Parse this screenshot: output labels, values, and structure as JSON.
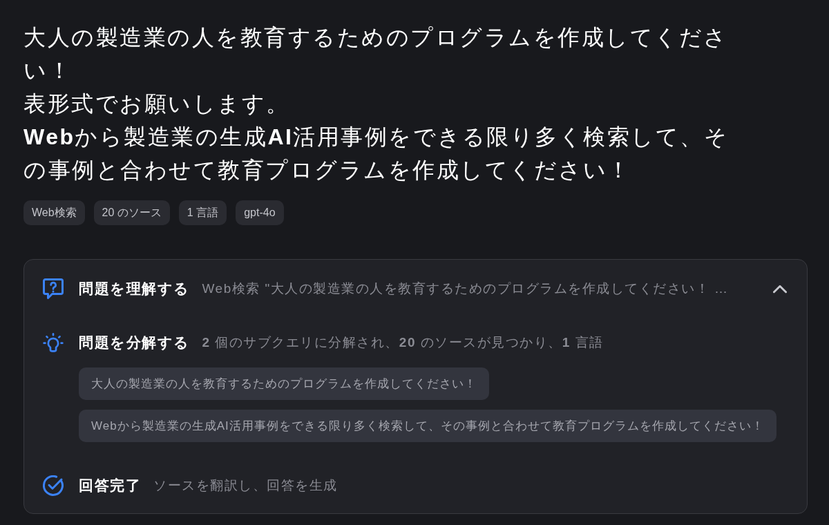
{
  "prompt_lines": [
    "大人の製造業の人を教育するためのプログラムを作成してください！",
    "表形式でお願いします。",
    "**Web**から製造業の生成**AI**活用事例をできる限り多く検索して、その事例と合わせて教育プログラムを作成してください！"
  ],
  "tags": [
    "Web検索",
    "20 のソース",
    "1 言語",
    "gpt-4o"
  ],
  "panel": {
    "expanded": true,
    "steps": [
      {
        "kind": "understand",
        "title": "問題を理解する",
        "description": "Web検索 \"大人の製造業の人を教育するためのプログラムを作成してください！ …"
      },
      {
        "kind": "decompose",
        "title": "問題を分解する",
        "description": "**2** 個のサブクエリに分解され、**20** のソースが見つかり、**1** 言語",
        "subqueries": [
          "大人の製造業の人を教育するためのプログラムを作成してください！",
          "Webから製造業の生成AI活用事例をできる限り多く検索して、その事例と合わせて教育プログラムを作成してください！"
        ]
      },
      {
        "kind": "done",
        "title": "回答完了",
        "description": "ソースを翻訳し、回答を生成"
      }
    ]
  }
}
